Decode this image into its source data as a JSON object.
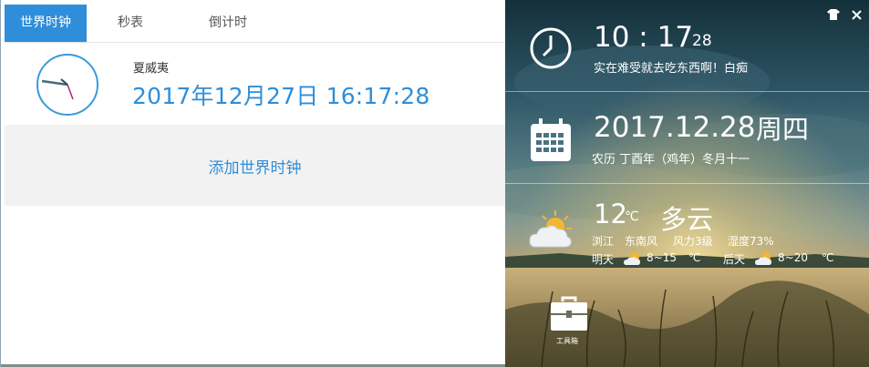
{
  "tabs": [
    {
      "label": "世界时钟",
      "active": true
    },
    {
      "label": "秒表",
      "active": false
    },
    {
      "label": "倒计时",
      "active": false
    }
  ],
  "world_clock": {
    "city": "夏威夷",
    "datetime": "2017年12月27日 16:17:28",
    "add_label": "添加世界时钟"
  },
  "panel": {
    "time": "10 : 17",
    "seconds": "28",
    "quote": "实在难受就去吃东西啊！白痴",
    "date": "2017.12.28",
    "weekday": "周四",
    "lunar": "农历 丁酉年（鸡年）冬月十一",
    "temperature": "12",
    "temperature_unit": "℃",
    "condition": "多云",
    "location": "浏江",
    "wind_direction": "东南风",
    "wind_level": "风力3级",
    "humidity": "湿度73%",
    "tomorrow_label": "明天",
    "tomorrow_range": "8~15",
    "dayafter_label": "后天",
    "dayafter_range": "8~20",
    "unit": "℃",
    "toolbox_label": "工具箱"
  },
  "icons": [
    "shirt-icon",
    "close-icon",
    "clock-icon",
    "calendar-icon",
    "weather-cloud-sun-icon",
    "toolbox-icon"
  ],
  "colors": {
    "accent": "#2f8ed9",
    "tab_active_bg": "#2f8ed9",
    "add_area_bg": "#f2f2f2"
  }
}
